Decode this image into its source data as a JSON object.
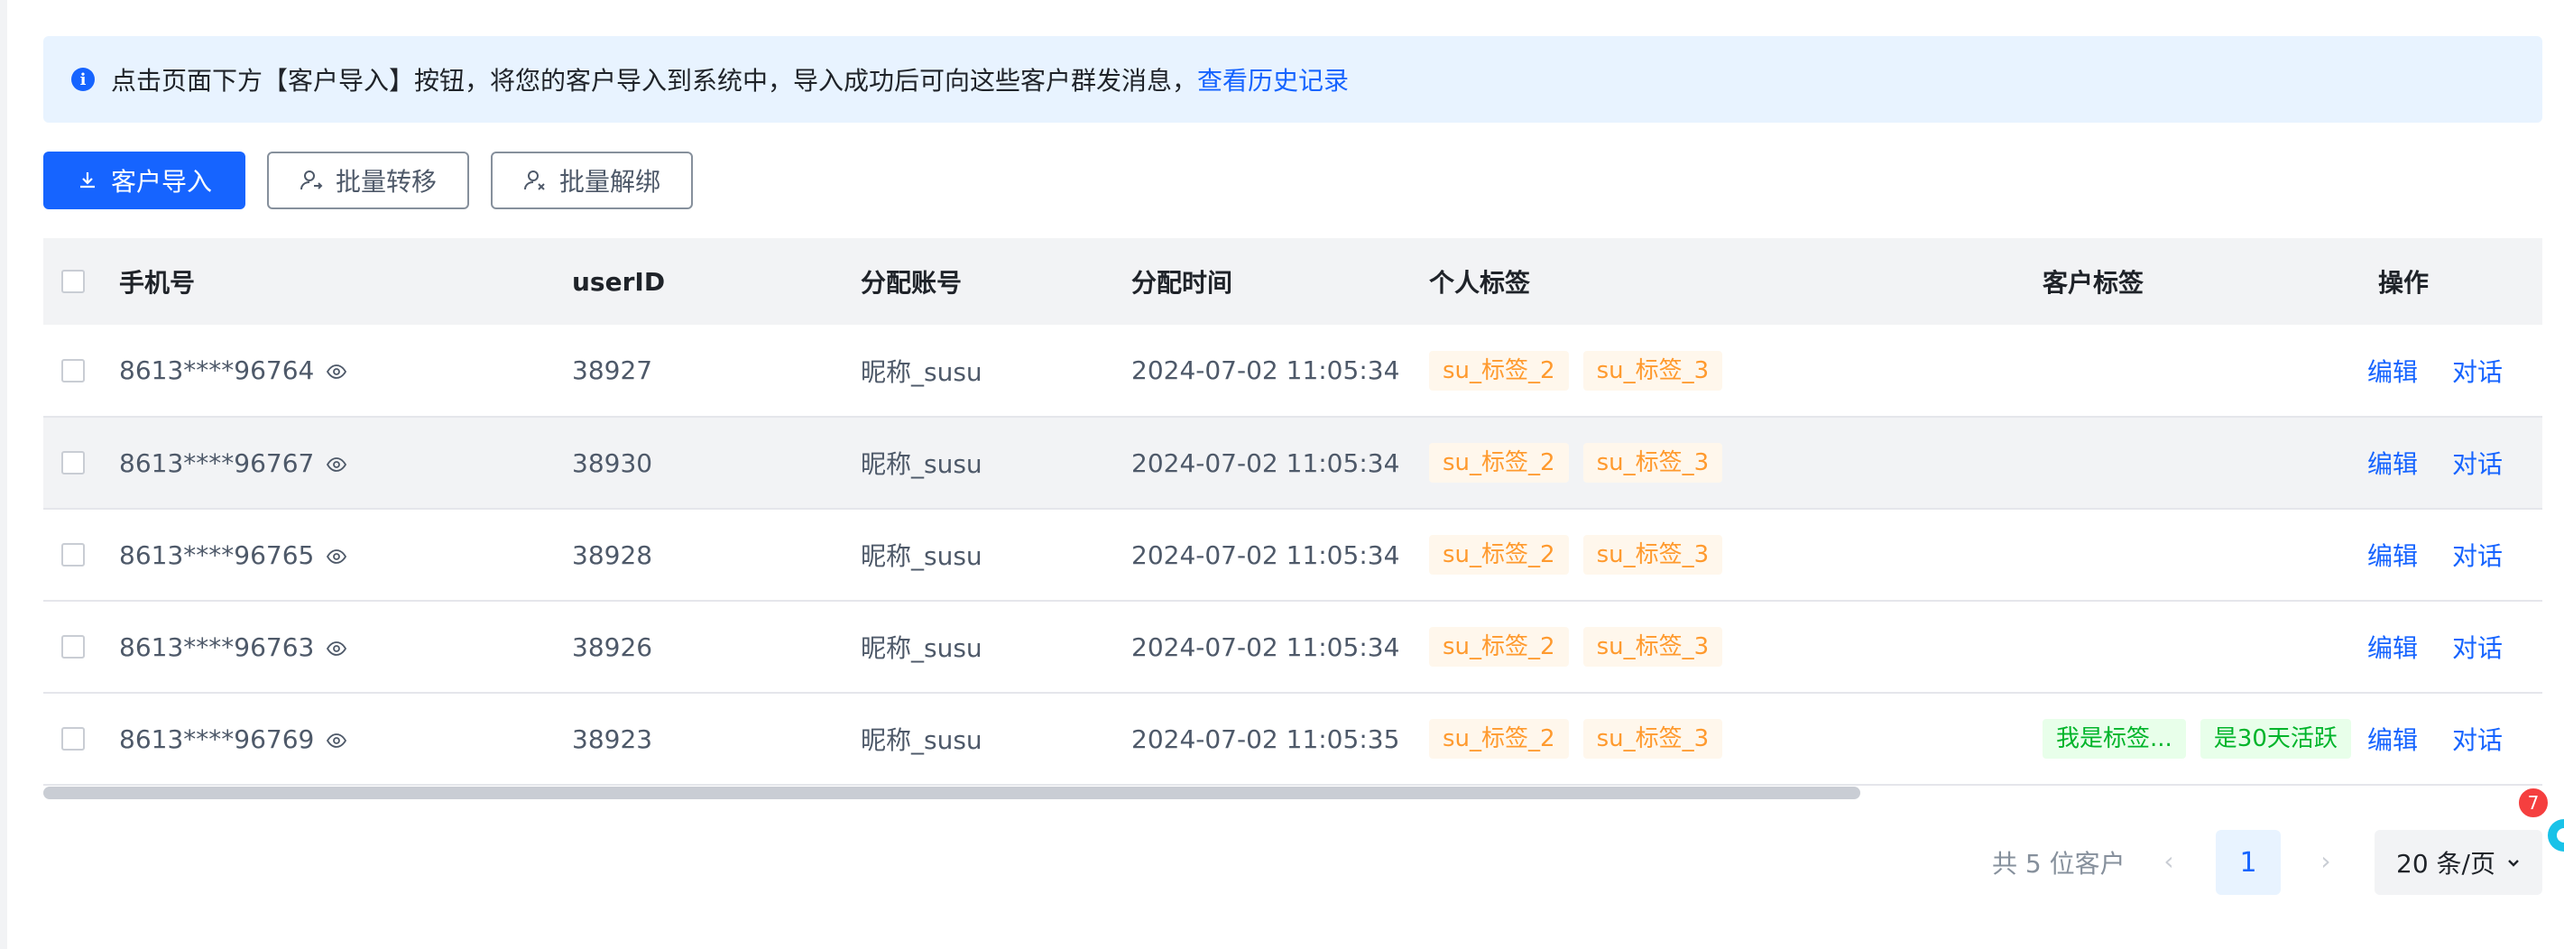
{
  "notice": {
    "text": "点击页面下方【客户导入】按钮，将您的客户导入到系统中，导入成功后可向这些客户群发消息，",
    "link": "查看历史记录"
  },
  "toolbar": {
    "import_label": "客户导入",
    "transfer_label": "批量转移",
    "unbind_label": "批量解绑"
  },
  "table": {
    "columns": [
      "手机号",
      "userID",
      "分配账号",
      "分配时间",
      "个人标签",
      "客户标签",
      "操作"
    ],
    "actions": {
      "edit": "编辑",
      "chat": "对话"
    },
    "rows": [
      {
        "phone": "8613****96764",
        "user_id": "38927",
        "account": "昵称_susu",
        "time": "2024-07-02 11:05:34",
        "personal_tags": [
          "su_标签_2",
          "su_标签_3"
        ],
        "customer_tags": []
      },
      {
        "phone": "8613****96767",
        "user_id": "38930",
        "account": "昵称_susu",
        "time": "2024-07-02 11:05:34",
        "personal_tags": [
          "su_标签_2",
          "su_标签_3"
        ],
        "customer_tags": []
      },
      {
        "phone": "8613****96765",
        "user_id": "38928",
        "account": "昵称_susu",
        "time": "2024-07-02 11:05:34",
        "personal_tags": [
          "su_标签_2",
          "su_标签_3"
        ],
        "customer_tags": []
      },
      {
        "phone": "8613****96763",
        "user_id": "38926",
        "account": "昵称_susu",
        "time": "2024-07-02 11:05:34",
        "personal_tags": [
          "su_标签_2",
          "su_标签_3"
        ],
        "customer_tags": []
      },
      {
        "phone": "8613****96769",
        "user_id": "38923",
        "account": "昵称_susu",
        "time": "2024-07-02 11:05:35",
        "personal_tags": [
          "su_标签_2",
          "su_标签_3"
        ],
        "customer_tags": [
          "我是标签...",
          "是30天活跃"
        ]
      }
    ],
    "hover_row": 1
  },
  "pagination": {
    "total": "共 5 位客户",
    "current": "1",
    "page_size": "20 条/页"
  },
  "float_badge": "7",
  "colors": {
    "primary": "#1664ff",
    "tag_orange": "#ff9a2e",
    "tag_green": "#00b42a",
    "notice_bg": "#e8f3ff"
  }
}
